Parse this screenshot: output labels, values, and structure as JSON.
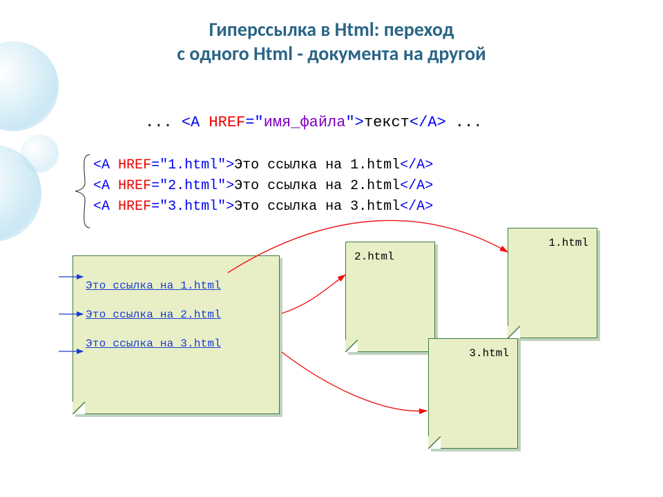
{
  "title_line1": "Гиперссылка в Html: переход",
  "title_line2": "с одного Html - документа на другой",
  "syntax": {
    "prefix": "...",
    "open_lt": "<",
    "tag": "a",
    "sp": " ",
    "attr": "href",
    "eq_q": "=\"",
    "value": "имя_файла",
    "q_gt": "\">",
    "content": "текст",
    "close": "</",
    "close_gt": ">",
    "suffix": " ..."
  },
  "examples": [
    {
      "file": "1.html",
      "text": "Это ссылка на 1.html"
    },
    {
      "file": "2.html",
      "text": "Это ссылка на 2.html"
    },
    {
      "file": "3.html",
      "text": "Это ссылка на 3.html"
    }
  ],
  "rendered_links": [
    "Это ссылка на 1.html",
    "Это ссылка на 2.html",
    "Это ссылка на 3.html"
  ],
  "targets": {
    "p1": "1.html",
    "p2": "2.html",
    "p3": "3.html"
  }
}
